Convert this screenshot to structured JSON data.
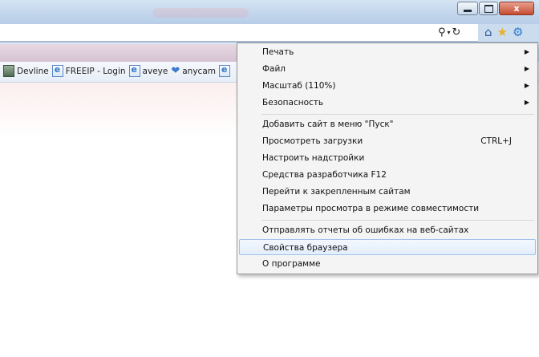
{
  "window": {
    "controls": {
      "minimize": "–",
      "maximize": "□",
      "close": "x"
    }
  },
  "toolbar": {
    "search_icon": "search-icon",
    "dropdown_icon": "▾",
    "refresh_icon": "refresh-icon"
  },
  "favorites": [
    {
      "label": "Devline",
      "icon": "devline-icon"
    },
    {
      "label": "FREEIP - Login",
      "icon": "ie-page-icon"
    },
    {
      "label": "aveye",
      "icon": "ie-page-icon"
    },
    {
      "label": "anycam",
      "icon": "heart-icon"
    }
  ],
  "menu": {
    "items": [
      {
        "label": "Печать",
        "submenu": true
      },
      {
        "label": "Файл",
        "submenu": true
      },
      {
        "label": "Масштаб (110%)",
        "submenu": true
      },
      {
        "label": "Безопасность",
        "submenu": true
      },
      {
        "label": "Добавить сайт в меню \"Пуск\""
      },
      {
        "label": "Просмотреть загрузки",
        "shortcut": "CTRL+J"
      },
      {
        "label": "Настроить надстройки"
      },
      {
        "label": "Средства разработчика F12"
      },
      {
        "label": "Перейти к закрепленным сайтам"
      },
      {
        "label": "Параметры просмотра в режиме совместимости"
      },
      {
        "label": "Отправлять отчеты об ошибках на веб-сайтах"
      },
      {
        "label": "Свойства браузера",
        "selected": true
      },
      {
        "label": "О программе"
      }
    ],
    "submenu_arrow": "▶"
  }
}
